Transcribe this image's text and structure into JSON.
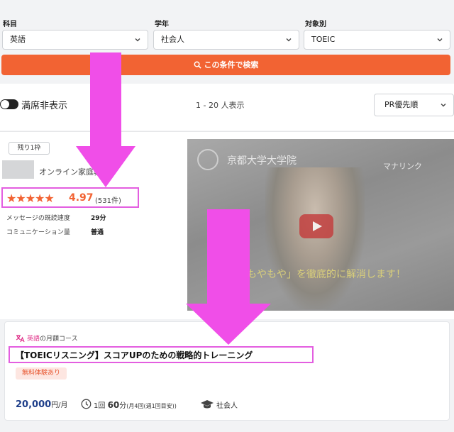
{
  "filters": {
    "subject": {
      "label": "科目",
      "value": "英語"
    },
    "grade": {
      "label": "学年",
      "value": "社会人"
    },
    "target": {
      "label": "対象別",
      "value": "TOEIC"
    },
    "search_button": "この条件で検索"
  },
  "results": {
    "toggle_label": "満席非表示",
    "count_text": "1 - 20 人表示",
    "sort_value": "PR優先順"
  },
  "tutor": {
    "slots_badge": "残り1枠",
    "type": "オンライン家庭教師",
    "stars": "★★★★★",
    "rating": "4.97",
    "rating_count": "(531件)",
    "stats": [
      {
        "label": "メッセージの既読速度",
        "value": "29分"
      },
      {
        "label": "コミュニケーション量",
        "value": "普通"
      }
    ],
    "video": {
      "title": "京都大学大学院",
      "brand": "マナリンク",
      "caption": "もやもや」を徹底的に解消します！"
    }
  },
  "course": {
    "subject": "英語",
    "course_type": "の月額コース",
    "title": "【TOEICリスニング】スコアUPのための戦略的トレーニング",
    "trial_badge": "無料体験あり",
    "price": "20,000",
    "price_unit": "円/月",
    "lesson_count_prefix": "1回",
    "lesson_minutes": "60",
    "lesson_minutes_unit": "分",
    "lesson_frequency": "(月4回(週1回目安))",
    "target": "社会人"
  },
  "colors": {
    "accent": "#f26333",
    "highlight": "#e35ee0",
    "arrow": "#f04ee8",
    "price": "#1f3f8a"
  }
}
